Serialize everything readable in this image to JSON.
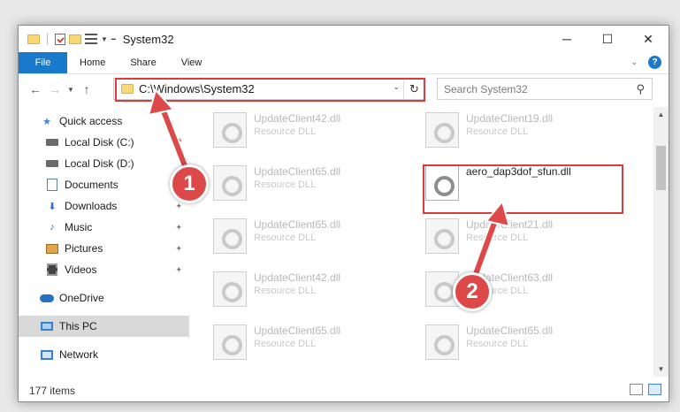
{
  "window": {
    "title": "System32"
  },
  "controls": {
    "minimize": "─",
    "maximize": "☐",
    "close": "✕"
  },
  "ribbon": {
    "tabs": [
      "File",
      "Home",
      "Share",
      "View"
    ],
    "help": "?"
  },
  "address": {
    "path": "C:\\Windows\\System32"
  },
  "search": {
    "placeholder": "Search System32"
  },
  "sidebar": {
    "items": [
      {
        "label": "Quick access",
        "icon": "star-icon"
      },
      {
        "label": "Local Disk (C:)",
        "icon": "disk-icon"
      },
      {
        "label": "Local Disk (D:)",
        "icon": "disk-icon"
      },
      {
        "label": "Documents",
        "icon": "documents-icon"
      },
      {
        "label": "Downloads",
        "icon": "download-icon",
        "pinned": true
      },
      {
        "label": "Music",
        "icon": "music-icon",
        "pinned": true
      },
      {
        "label": "Pictures",
        "icon": "pictures-icon",
        "pinned": true
      },
      {
        "label": "Videos",
        "icon": "videos-icon",
        "pinned": true
      },
      {
        "label": "OneDrive",
        "icon": "cloud-icon"
      },
      {
        "label": "This PC",
        "icon": "pc-icon",
        "selected": true
      },
      {
        "label": "Network",
        "icon": "network-icon"
      }
    ]
  },
  "files": [
    {
      "name": "UpdateClient42.dll",
      "type": "Resource DLL"
    },
    {
      "name": "UpdateClient19.dll",
      "type": "Resource DLL"
    },
    {
      "name": "UpdateClient65.dll",
      "type": "Resource DLL"
    },
    {
      "name": "aero_dap3dof_sfun.dll",
      "type": ""
    },
    {
      "name": "UpdateClient65.dll",
      "type": "Resource DLL"
    },
    {
      "name": "UpdateClient21.dll",
      "type": "Resource DLL"
    },
    {
      "name": "UpdateClient42.dll",
      "type": "Resource DLL"
    },
    {
      "name": "UpdateClient63.dll",
      "type": "Resource DLL"
    },
    {
      "name": "UpdateClient65.dll",
      "type": "Resource DLL"
    },
    {
      "name": "UpdateClient65.dll",
      "type": "Resource DLL"
    }
  ],
  "status": {
    "count": "177 items"
  },
  "annotations": {
    "step1": "1",
    "step2": "2",
    "color": "#dd4848"
  }
}
